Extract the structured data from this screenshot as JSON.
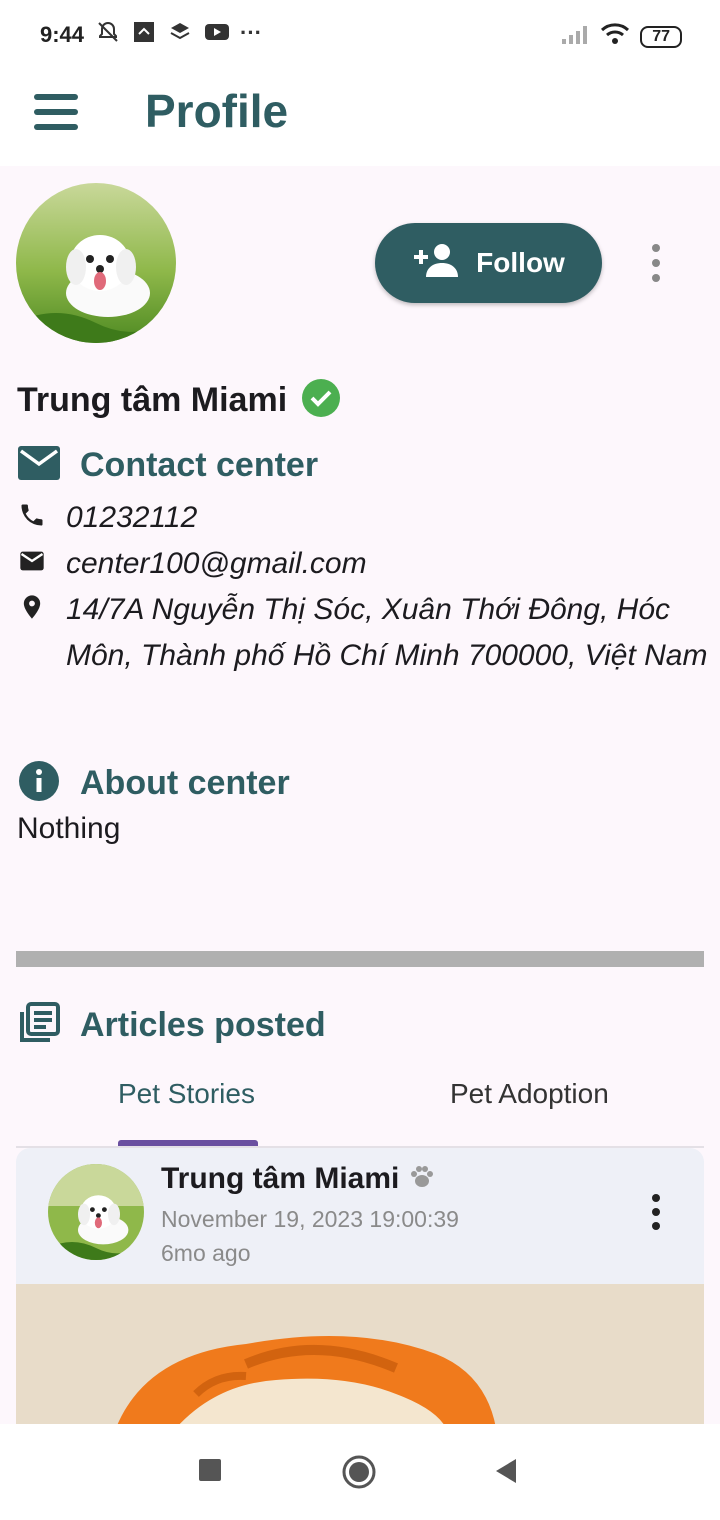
{
  "status_bar": {
    "time": "9:44",
    "battery": "77",
    "more": "···"
  },
  "app_bar": {
    "title": "Profile"
  },
  "profile": {
    "follow_label": "Follow",
    "name": "Trung tâm Miami"
  },
  "contact": {
    "title": "Contact center",
    "phone": "01232112",
    "email": "center100@gmail.com",
    "address": "14/7A Nguyễn Thị Sóc, Xuân Thới Đông, Hóc Môn, Thành phố Hồ Chí Minh 700000, Việt Nam"
  },
  "about": {
    "title": "About center",
    "text": "Nothing"
  },
  "articles": {
    "title": "Articles posted",
    "tabs": [
      "Pet Stories",
      "Pet Adoption"
    ]
  },
  "post": {
    "author": "Trung tâm Miami",
    "date": "November 19, 2023 19:00:39",
    "ago": "6mo ago"
  },
  "colors": {
    "accent": "#2f5d62",
    "verified": "#4caf50",
    "tab_indicator": "#6a4fa0"
  }
}
